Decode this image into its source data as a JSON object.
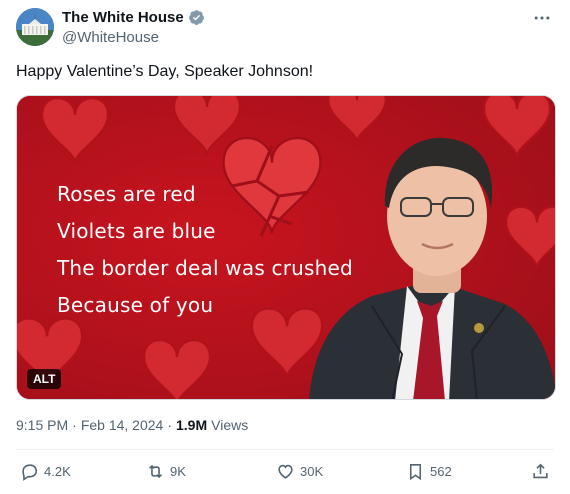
{
  "author": {
    "name": "The White House",
    "handle": "@WhiteHouse"
  },
  "tweet": {
    "text": "Happy Valentine’s Day, Speaker Johnson!"
  },
  "media": {
    "poem": [
      "Roses are red",
      "Violets are blue",
      "The border deal was crushed",
      "Because of you"
    ],
    "alt_label": "ALT"
  },
  "meta": {
    "time": "9:15 PM",
    "separator": "·",
    "date": "Feb 14, 2024",
    "views_count": "1.9M",
    "views_label": "Views"
  },
  "actions": {
    "replies": "4.2K",
    "reposts": "9K",
    "likes": "30K",
    "bookmarks": "562"
  },
  "colors": {
    "verified": "#829aab",
    "card_red": "#b1111d",
    "heart_red": "#e0383d"
  },
  "icons": [
    "verified-badge-icon",
    "more-icon",
    "reply-icon",
    "repost-icon",
    "like-icon",
    "bookmark-icon",
    "share-icon"
  ]
}
